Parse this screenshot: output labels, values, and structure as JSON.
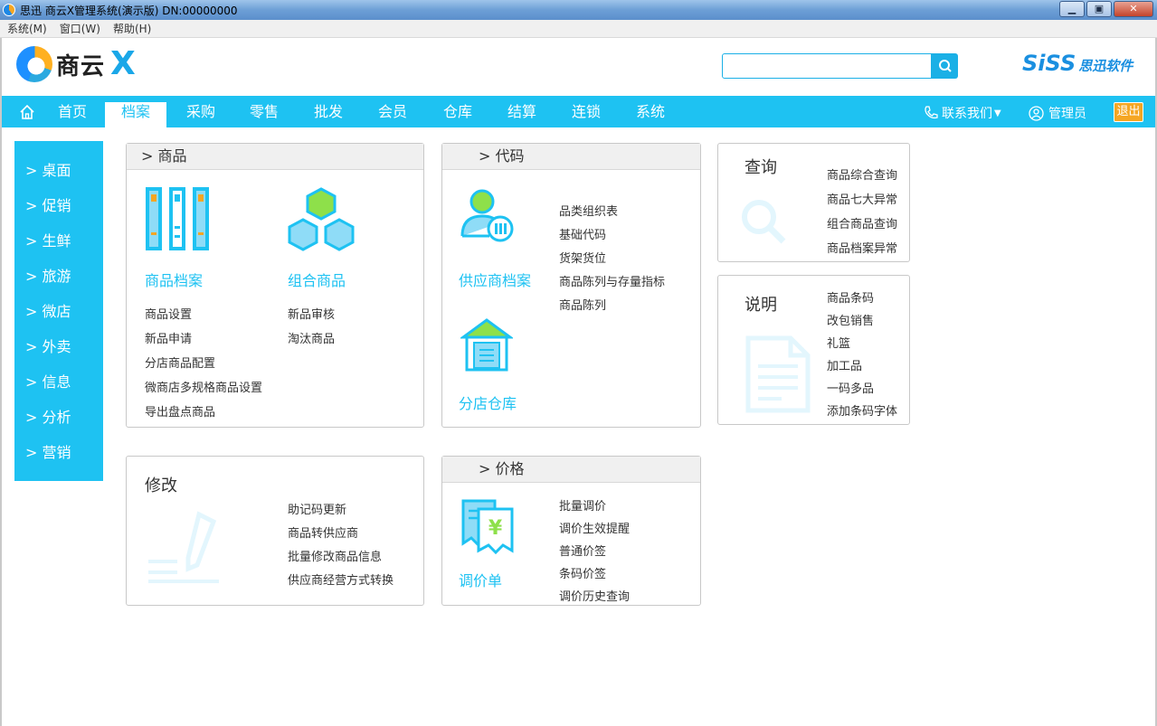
{
  "window": {
    "title": "思迅 商云X管理系统(演示版) DN:00000000",
    "minimize": "▁",
    "maximize": "▣",
    "close": "✕"
  },
  "menubar": {
    "items": [
      "系统(M)",
      "窗口(W)",
      "帮助(H)"
    ]
  },
  "header": {
    "brand": "商云",
    "brand_x": "X",
    "search_placeholder": "",
    "vendor_a": "SiSS",
    "vendor_b": "思迅软件"
  },
  "nav": {
    "items": [
      "首页",
      "档案",
      "采购",
      "零售",
      "批发",
      "会员",
      "仓库",
      "结算",
      "连锁",
      "系统"
    ],
    "active": "档案",
    "contact": "联系我们",
    "user": "管理员",
    "logout": "退出"
  },
  "sidebar": {
    "items": [
      "> 桌面",
      "> 促销",
      "> 生鲜",
      "> 旅游",
      "> 微店",
      "> 外卖",
      "> 信息",
      "> 分析",
      "> 营销"
    ]
  },
  "panels": {
    "goods": {
      "head": ">  商品",
      "icon1_label": "商品档案",
      "icon2_label": "组合商品",
      "col1": [
        "商品设置",
        "新品申请",
        "分店商品配置",
        "微商店多规格商品设置",
        "导出盘点商品"
      ],
      "col2": [
        "新品审核",
        "淘汰商品"
      ]
    },
    "code": {
      "head": ">  代码",
      "icon1_label": "供应商档案",
      "icon2_label": "分店仓库",
      "links": [
        "品类组织表",
        "基础代码",
        "货架货位",
        "商品陈列与存量指标",
        "商品陈列"
      ]
    },
    "query": {
      "title": "查询",
      "links": [
        "商品综合查询",
        "商品七大异常",
        "组合商品查询",
        "商品档案异常"
      ]
    },
    "note": {
      "title": "说明",
      "links": [
        "商品条码",
        "改包销售",
        "礼篮",
        "加工品",
        "一码多品",
        "添加条码字体"
      ]
    },
    "modify": {
      "title": "修改",
      "links": [
        "助记码更新",
        "商品转供应商",
        "批量修改商品信息",
        "供应商经营方式转换"
      ]
    },
    "price": {
      "head": ">  价格",
      "icon_label": "调价单",
      "links": [
        "批量调价",
        "调价生效提醒",
        "普通价签",
        "条码价签",
        "调价历史查询"
      ]
    }
  },
  "colors": {
    "accent": "#1ec2f2",
    "orange": "#f5a623"
  }
}
